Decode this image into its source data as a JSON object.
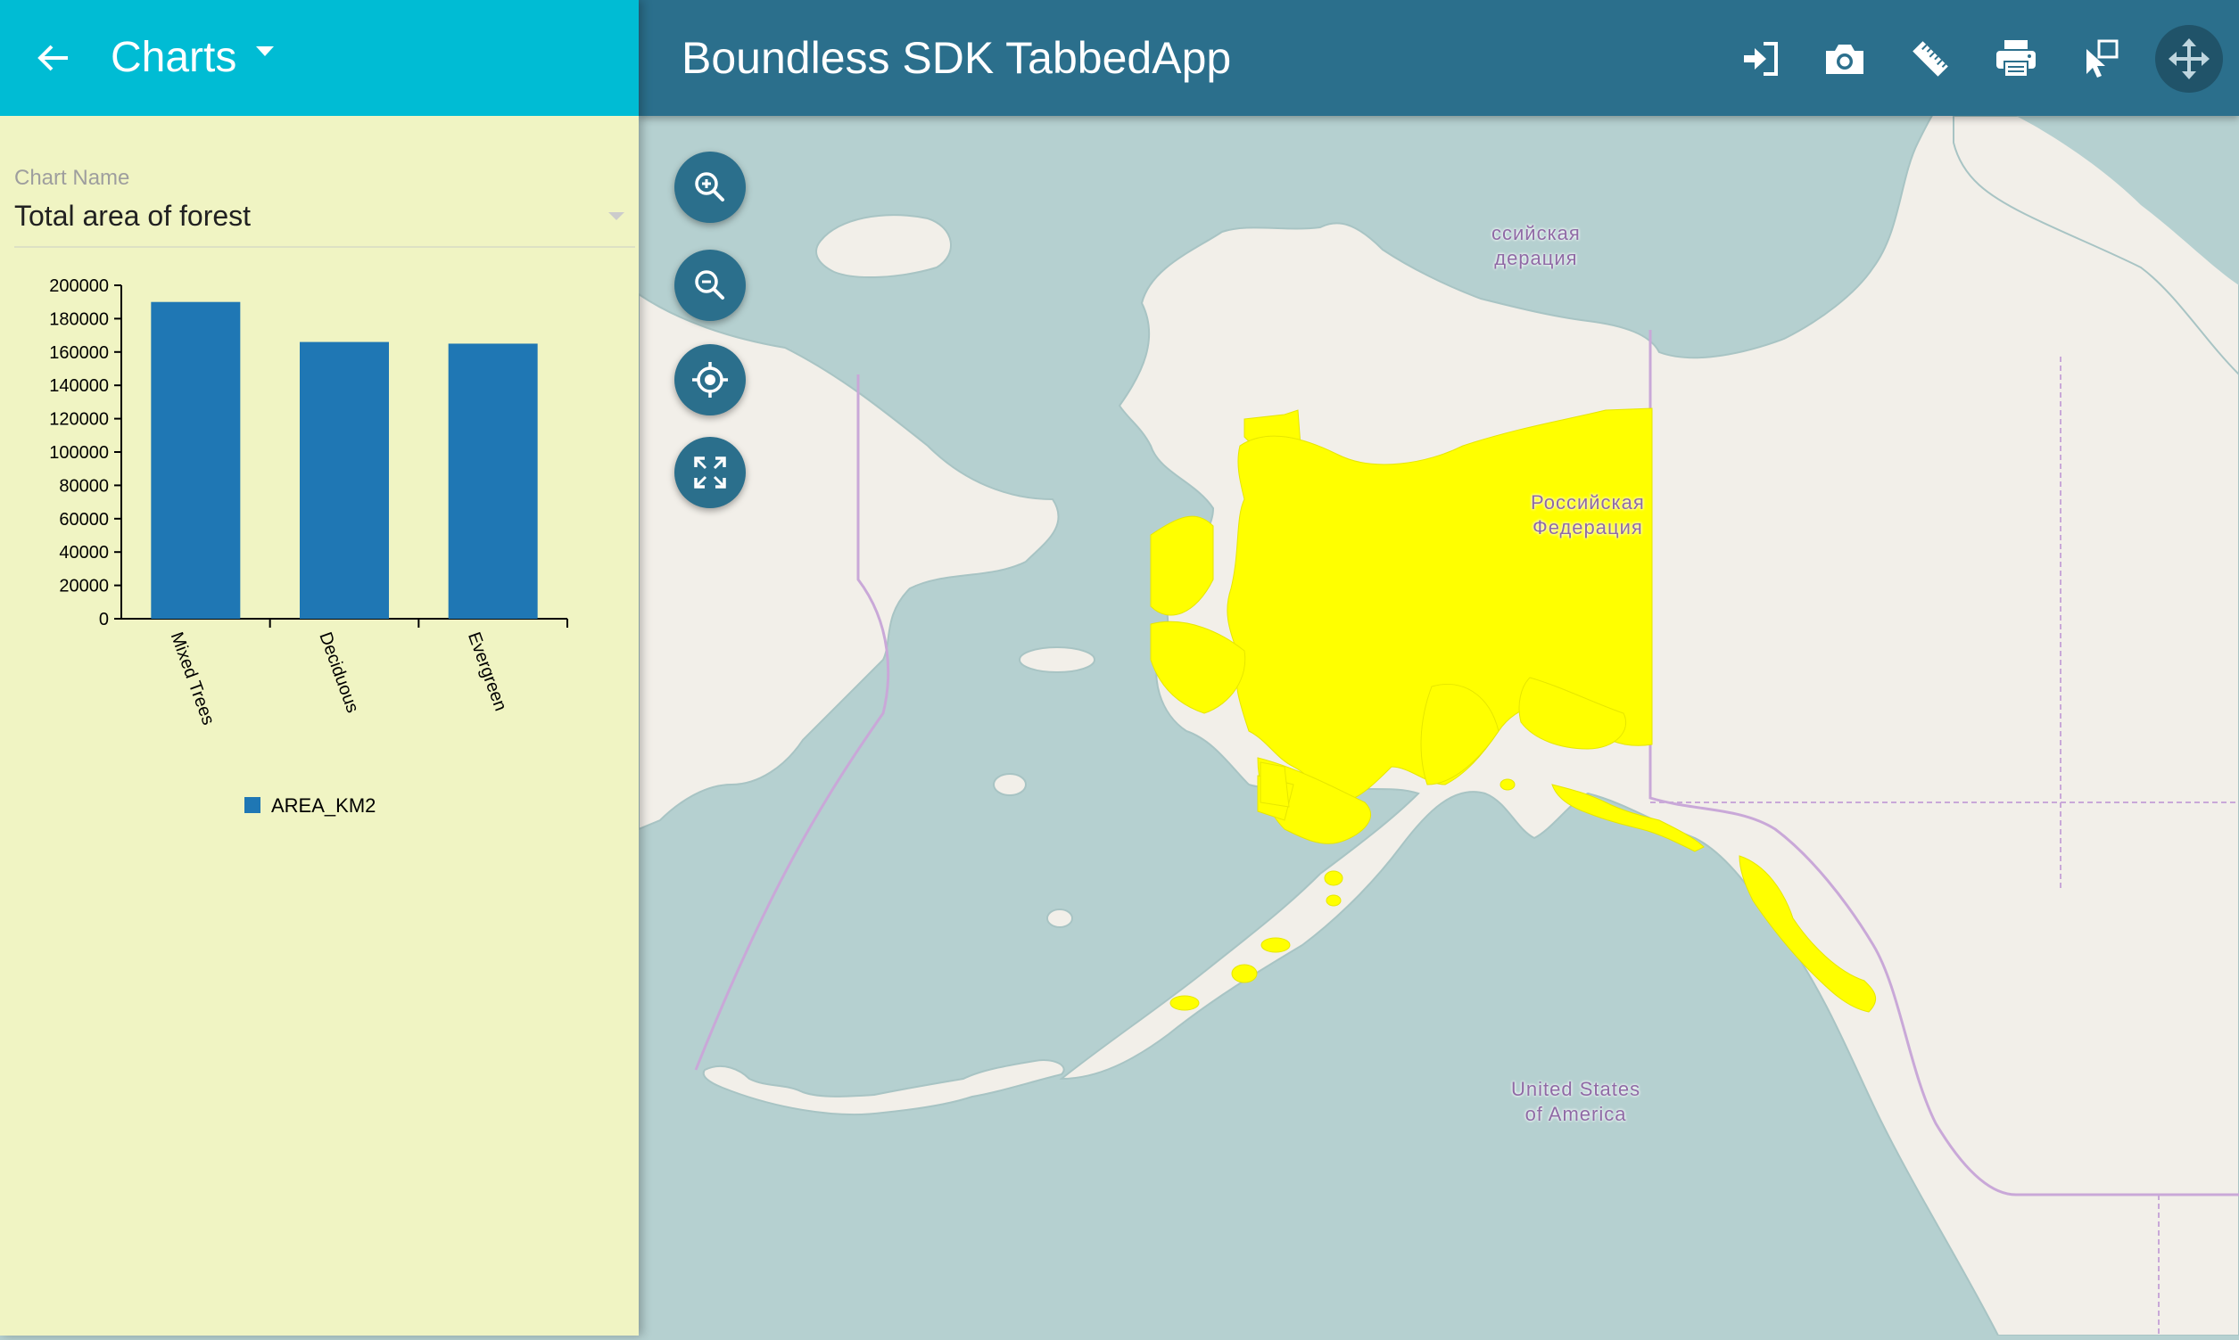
{
  "sidebar": {
    "title": "Charts",
    "back_icon": "arrow-left-icon",
    "title_dropdown_icon": "caret-down-icon",
    "header_color": "#00bcd4",
    "background_color": "#f0f4c3",
    "chart_select": {
      "label": "Chart Name",
      "value": "Total area of forest"
    }
  },
  "chart_data": {
    "type": "bar",
    "categories": [
      "Mixed Trees",
      "Deciduous",
      "Evergreen"
    ],
    "series": [
      {
        "name": "AREA_KM2",
        "values": [
          190000,
          166000,
          165000
        ],
        "color": "#1f77b4"
      }
    ],
    "yticks": [
      "200000",
      "180000",
      "160000",
      "140000",
      "120000",
      "100000",
      "80000",
      "60000",
      "40000",
      "20000",
      "0"
    ],
    "ylim": [
      0,
      200000
    ],
    "legend": {
      "placement": "bottom-center",
      "label": "AREA_KM2"
    },
    "grid": false
  },
  "header": {
    "title": "Boundless SDK TabbedApp",
    "background_color": "#2b6f8c",
    "tools": [
      {
        "name": "login",
        "icon": "sign-in-icon"
      },
      {
        "name": "export-image",
        "icon": "camera-icon"
      },
      {
        "name": "measure",
        "icon": "ruler-icon"
      },
      {
        "name": "print",
        "icon": "printer-icon"
      },
      {
        "name": "select",
        "icon": "select-pointer-icon"
      },
      {
        "name": "navigation",
        "icon": "move-arrows-icon",
        "active": true
      }
    ]
  },
  "map": {
    "controls": [
      {
        "name": "zoom-in",
        "icon": "zoom-in-icon"
      },
      {
        "name": "zoom-out",
        "icon": "zoom-out-icon"
      },
      {
        "name": "geolocation",
        "icon": "crosshair-icon"
      },
      {
        "name": "fullscreen",
        "icon": "fullscreen-icon"
      }
    ],
    "labels": {
      "russia_top_line1": "ссийская",
      "russia_top_line2": "дерация",
      "russia_line1": "Российская",
      "russia_line2": "Федерация",
      "usa_line1": "United States",
      "usa_line2": "of America"
    },
    "colors": {
      "water": "#b5d0d0",
      "land": "#f2efe9",
      "forest_layer": "#ffff00",
      "border": "#c9a8d8"
    }
  }
}
